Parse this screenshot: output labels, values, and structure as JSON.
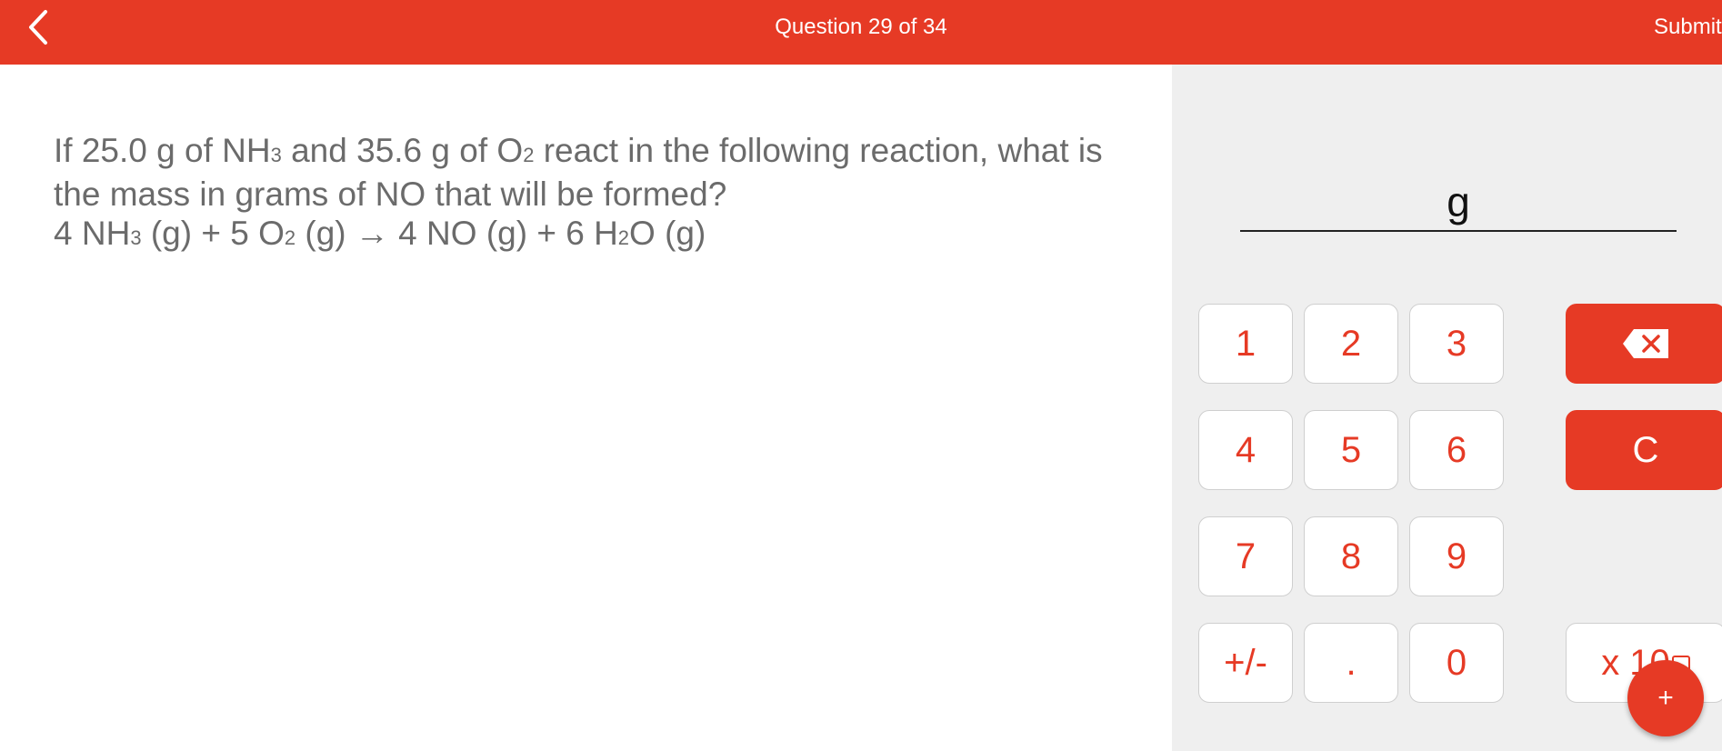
{
  "header": {
    "title": "Question 29 of 34",
    "submit_label": "Submit"
  },
  "question": {
    "line1": {
      "a": "If 25.0 g of NH",
      "s1": "3",
      "b": " and 35.6 g of O",
      "s2": "2",
      "c": " react in the following reaction, what is"
    },
    "line2": "the mass in grams of NO that will be formed?",
    "line3": {
      "a": "4 NH",
      "s1": "3",
      "b": " (g) + 5 O",
      "s2": "2",
      "c": " (g) → 4 NO (g) + 6 H",
      "s3": "2",
      "d": "O (g)"
    }
  },
  "answer": {
    "unit": "g"
  },
  "keypad": {
    "k1": "1",
    "k2": "2",
    "k3": "3",
    "k4": "4",
    "k5": "5",
    "k6": "6",
    "k7": "7",
    "k8": "8",
    "k9": "9",
    "plusminus": "+/-",
    "dot": ".",
    "k0": "0",
    "clear": "C",
    "exponent": "x 10",
    "plus": "+"
  },
  "colors": {
    "accent": "#e63a25",
    "panel_bg": "#efefef",
    "question_text": "#6b6b6b"
  },
  "icons": {
    "back": "chevron-left-icon",
    "backspace": "backspace-icon"
  }
}
